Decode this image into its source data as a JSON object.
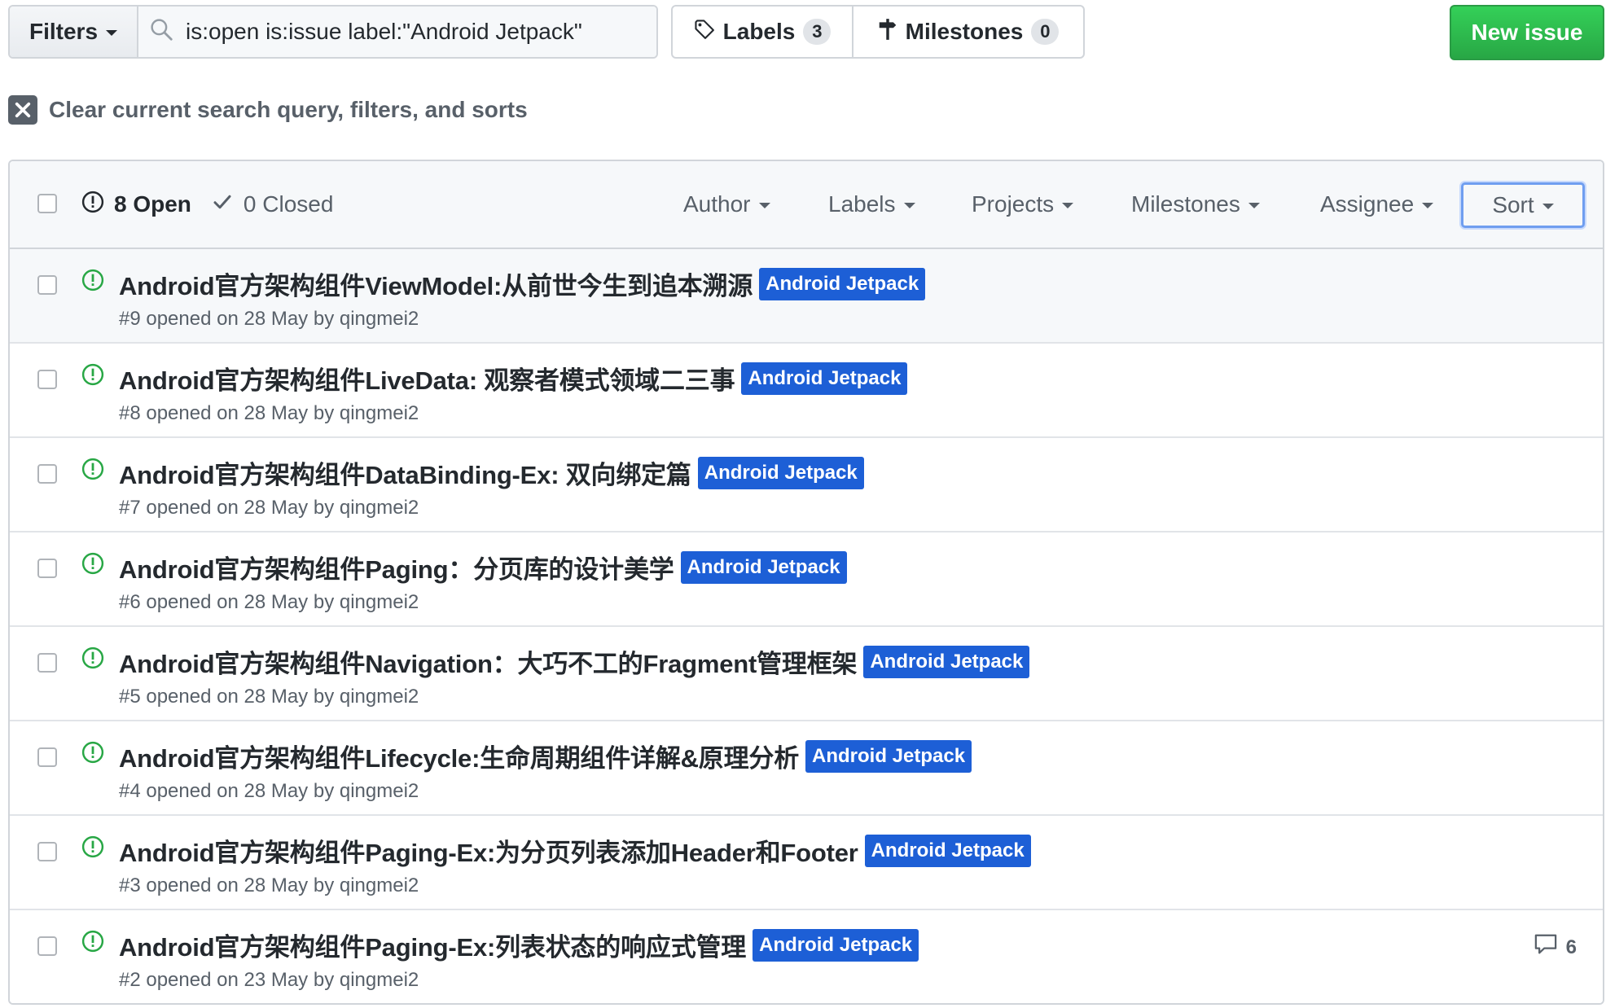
{
  "toolbar": {
    "filters_label": "Filters",
    "search_value": "is:open is:issue label:\"Android Jetpack\"",
    "labels_label": "Labels",
    "labels_count": "3",
    "milestones_label": "Milestones",
    "milestones_count": "0",
    "new_issue_label": "New issue"
  },
  "clear": {
    "label": "Clear current search query, filters, and sorts"
  },
  "header": {
    "open_label": "8 Open",
    "closed_label": "0 Closed",
    "menus": {
      "author": "Author",
      "labels": "Labels",
      "projects": "Projects",
      "milestones": "Milestones",
      "assignee": "Assignee",
      "sort": "Sort"
    }
  },
  "issues": [
    {
      "title": "Android官方架构组件ViewModel:从前世今生到追本溯源",
      "label": "Android Jetpack",
      "meta": "#9 opened on 28 May by qingmei2",
      "comments": ""
    },
    {
      "title": "Android官方架构组件LiveData: 观察者模式领域二三事",
      "label": "Android Jetpack",
      "meta": "#8 opened on 28 May by qingmei2",
      "comments": ""
    },
    {
      "title": "Android官方架构组件DataBinding-Ex: 双向绑定篇",
      "label": "Android Jetpack",
      "meta": "#7 opened on 28 May by qingmei2",
      "comments": ""
    },
    {
      "title": "Android官方架构组件Paging：分页库的设计美学",
      "label": "Android Jetpack",
      "meta": "#6 opened on 28 May by qingmei2",
      "comments": ""
    },
    {
      "title": "Android官方架构组件Navigation：大巧不工的Fragment管理框架",
      "label": "Android Jetpack",
      "meta": "#5 opened on 28 May by qingmei2",
      "comments": ""
    },
    {
      "title": "Android官方架构组件Lifecycle:生命周期组件详解&原理分析",
      "label": "Android Jetpack",
      "meta": "#4 opened on 28 May by qingmei2",
      "comments": ""
    },
    {
      "title": "Android官方架构组件Paging-Ex:为分页列表添加Header和Footer",
      "label": "Android Jetpack",
      "meta": "#3 opened on 28 May by qingmei2",
      "comments": ""
    },
    {
      "title": "Android官方架构组件Paging-Ex:列表状态的响应式管理",
      "label": "Android Jetpack",
      "meta": "#2 opened on 23 May by qingmei2",
      "comments": "6"
    }
  ],
  "colors": {
    "accent_green": "#28a745",
    "label_blue": "#1d5fd6",
    "open_icon_green": "#28a745"
  },
  "icons": {
    "search": "search-icon",
    "tag": "tag-icon",
    "milestone": "milestone-icon",
    "clear": "close-icon",
    "issue_opened": "issue-opened-icon",
    "check": "check-icon",
    "comment": "comment-icon"
  }
}
